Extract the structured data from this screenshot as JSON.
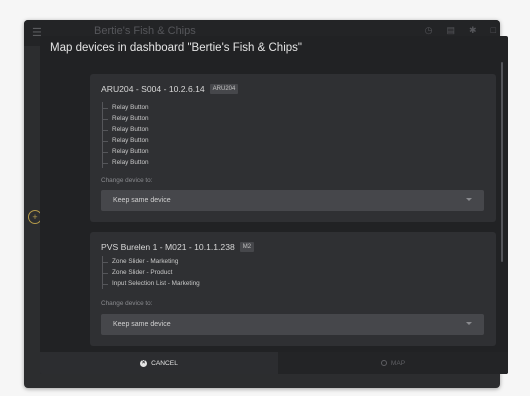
{
  "app": {
    "topbar_title": "Bertie's Fish & Chips"
  },
  "modal": {
    "title": "Map devices in dashboard \"Bertie's Fish & Chips\"",
    "change_label": "Change device to:",
    "devices": [
      {
        "name": "ARU204 - S004 - 10.2.6.14",
        "tag": "ARU204",
        "widgets": [
          "Relay Button",
          "Relay Button",
          "Relay Button",
          "Relay Button",
          "Relay Button",
          "Relay Button"
        ],
        "selected": "Keep same device"
      },
      {
        "name": "PVS Burelen 1 - M021 - 10.1.1.238",
        "tag": "M2",
        "widgets": [
          "Zone Slider - Marketing",
          "Zone Slider - Product",
          "Input Selection List - Marketing"
        ],
        "selected": "Keep same device"
      }
    ],
    "cancel_label": "CANCEL",
    "map_label": "MAP"
  }
}
